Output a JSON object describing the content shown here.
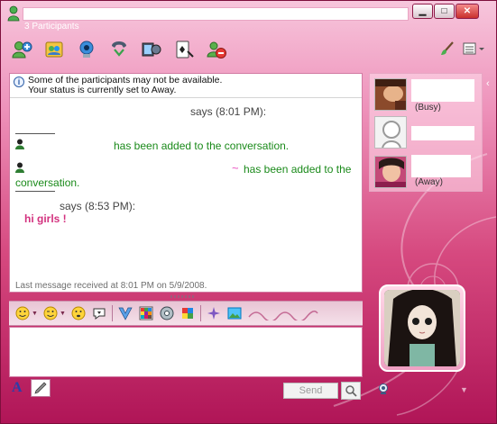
{
  "window": {
    "participants_label": "3 Participants",
    "controls": {
      "minimize": "▁",
      "maximize": "□",
      "close": "✕"
    }
  },
  "toolbar": {
    "items": [
      {
        "icon": "add-contact-icon"
      },
      {
        "icon": "group-icon"
      },
      {
        "icon": "video-call-icon"
      },
      {
        "icon": "phone-icon"
      },
      {
        "icon": "media-icon"
      },
      {
        "icon": "games-icon"
      },
      {
        "icon": "block-icon"
      }
    ],
    "right": [
      {
        "icon": "paintbrush-icon"
      },
      {
        "icon": "menu-icon"
      }
    ]
  },
  "conversation": {
    "notice_line1": "Some of the participants may not be available.",
    "notice_line2": "Your status is currently set to Away.",
    "says_1": "says (8:01 PM):",
    "added_1": "has been added to the conversation.",
    "tilde": "~",
    "added_2a": "has been added to the",
    "added_2b": "conversation.",
    "says_2": "says (8:53 PM):",
    "message": "hi girls !",
    "last_message": "Last message received at 8:01 PM on 5/9/2008."
  },
  "input_area": {
    "send_label": "Send",
    "font_glyph": "A"
  },
  "participants_panel": {
    "items": [
      {
        "status": "(Busy)"
      },
      {
        "status": ""
      },
      {
        "status": "(Away)"
      }
    ]
  },
  "colors": {
    "frame": "#c2185b",
    "added_text": "#1a8a1a",
    "message_text": "#d3327f"
  }
}
